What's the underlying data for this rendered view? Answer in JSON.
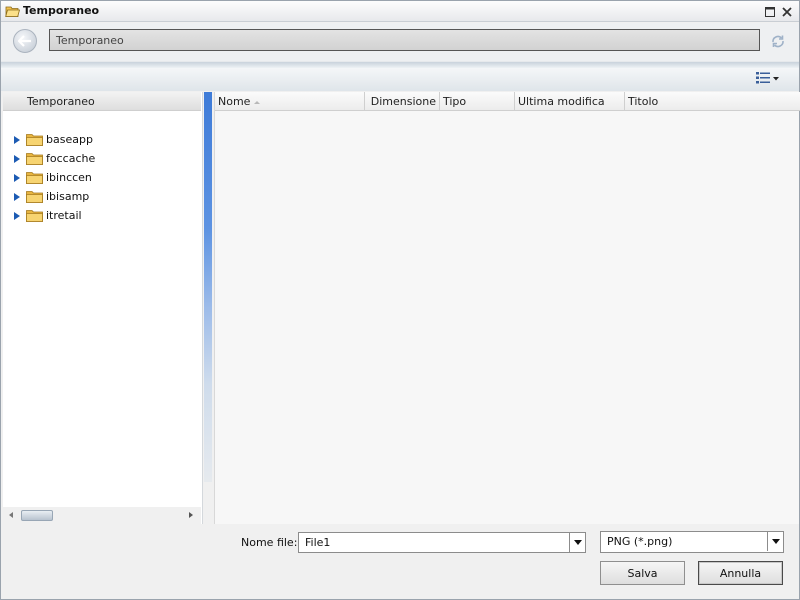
{
  "window": {
    "title": "Temporaneo"
  },
  "nav": {
    "current_path": "Temporaneo"
  },
  "tree": {
    "header": "Temporaneo",
    "items": [
      {
        "label": "baseapp"
      },
      {
        "label": "foccache"
      },
      {
        "label": "ibinccen"
      },
      {
        "label": "ibisamp"
      },
      {
        "label": "itretail"
      }
    ]
  },
  "file_list": {
    "columns": {
      "name": "Nome",
      "size": "Dimensione",
      "type": "Tipo",
      "modified": "Ultima modifica",
      "title": "Titolo"
    },
    "rows": []
  },
  "footer": {
    "filename_label": "Nome file:",
    "filename_value": "File1",
    "filetype_value": "PNG (*.png)",
    "save_label": "Salva",
    "cancel_label": "Annulla"
  },
  "colors": {
    "accent_blue": "#3e7bd8",
    "folder_yellow": "#f2c14e",
    "tree_expander": "#1c5bb3"
  },
  "icons": {
    "app": "open-folder-icon",
    "back": "back-arrow-icon",
    "refresh": "refresh-icon",
    "view": "details-view-icon",
    "folder": "folder-icon"
  }
}
